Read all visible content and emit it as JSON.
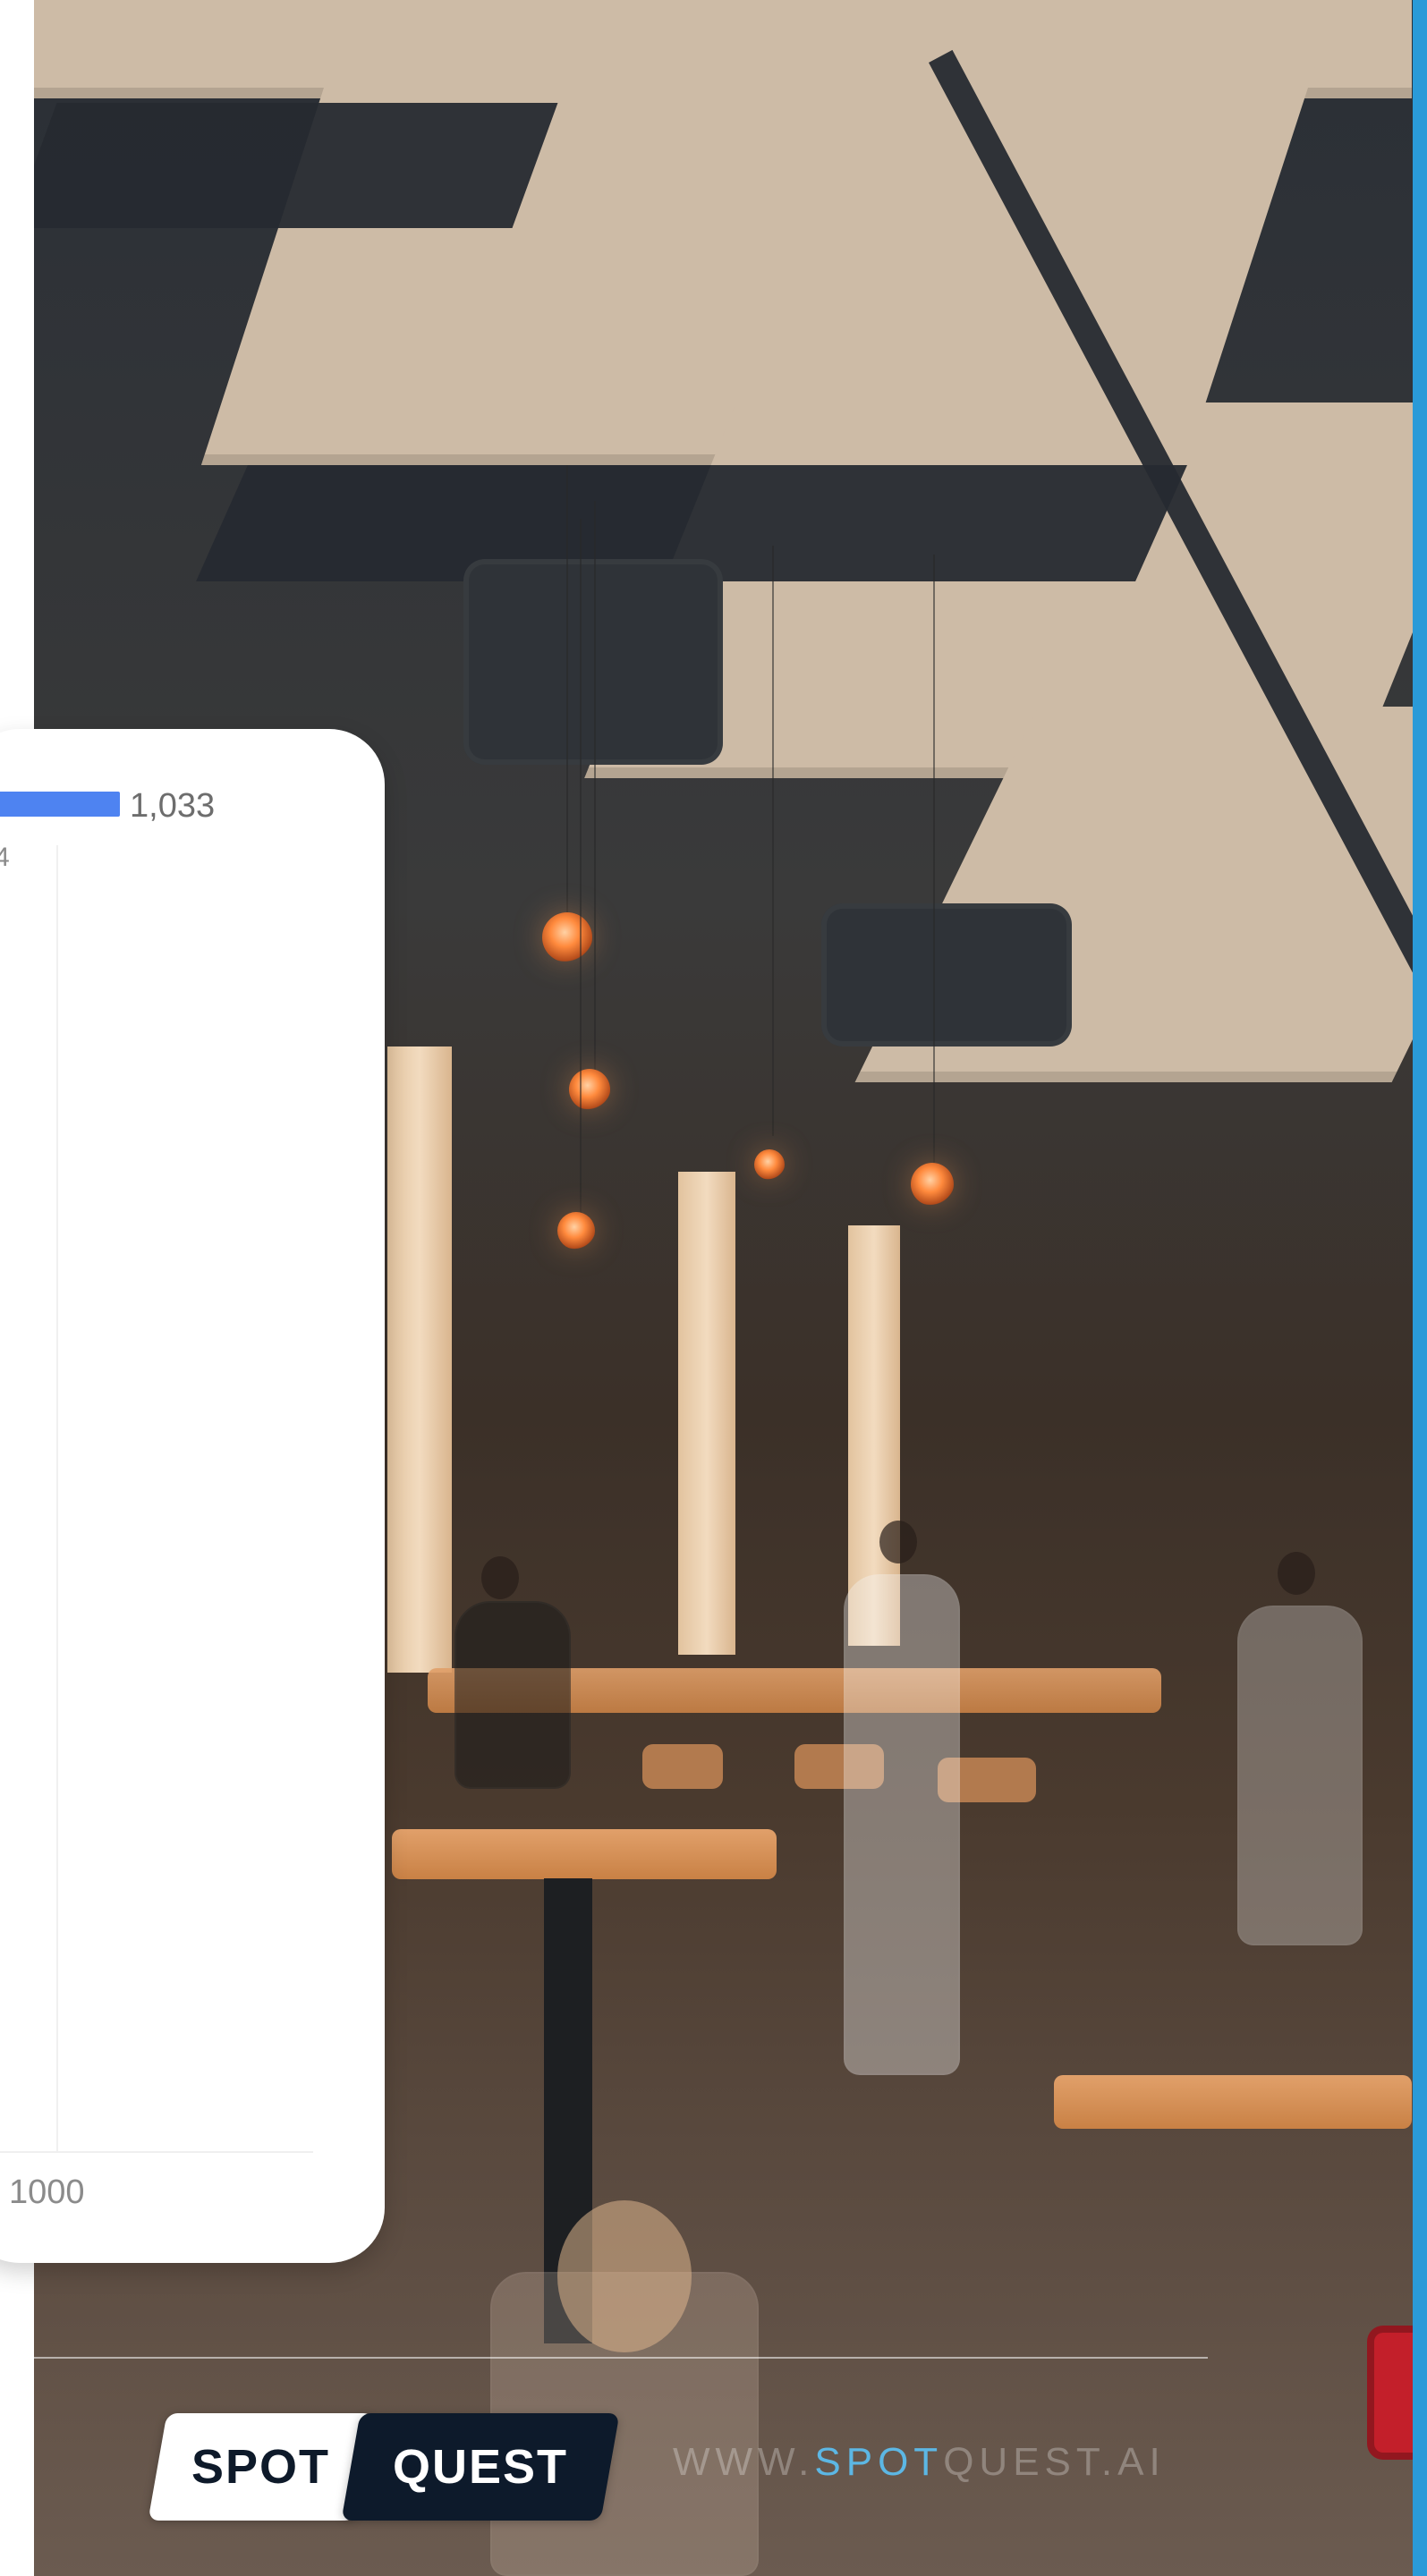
{
  "scene": {
    "type": "photo",
    "overlay_card": {
      "bar_value_label": "1,033",
      "bar_fraction": 0.27,
      "tiny_label": "4",
      "x_tick": "1000"
    }
  },
  "branding": {
    "logo_left": "SPOT",
    "logo_right": "QUEST",
    "website_prefix": "WWW.",
    "website_accent": "SPOT",
    "website_suffix": "QUEST.AI"
  },
  "colors": {
    "accent_blue": "#4e83f1",
    "right_accent": "#2a9ad8",
    "logo_dark": "#0d1a2b"
  }
}
